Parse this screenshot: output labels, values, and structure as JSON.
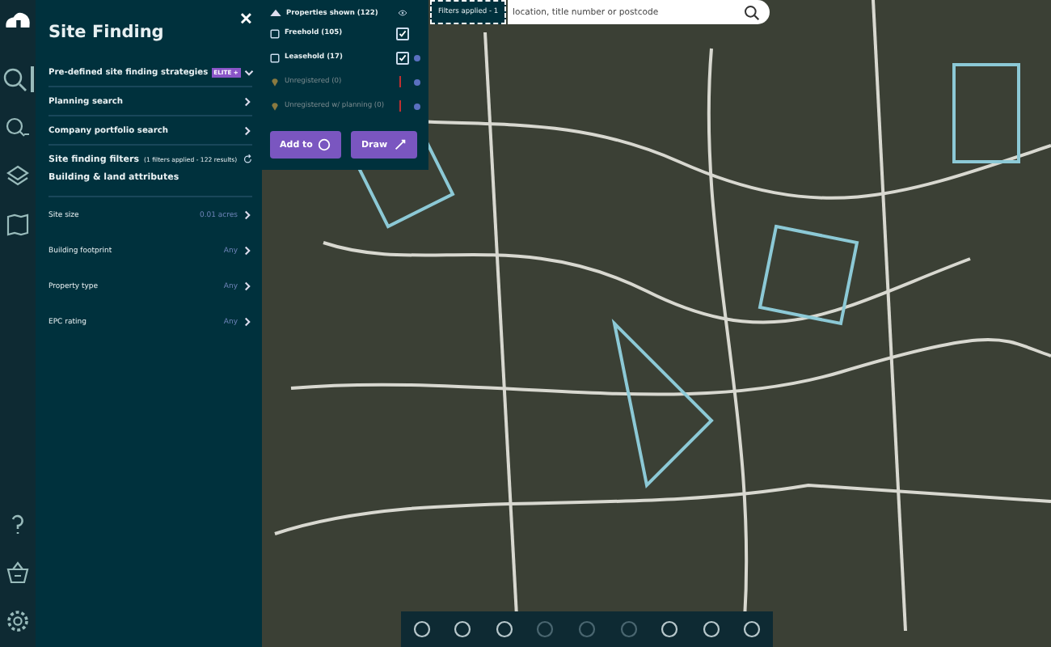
{
  "rail": {
    "top": [
      {
        "selected": true
      },
      {
        "selected": false
      },
      {
        "selected": false
      },
      {
        "selected": false
      }
    ]
  },
  "panel": {
    "title": "Site Finding",
    "close": "✕",
    "nav": [
      {
        "label": "Pre-defined site finding strategies",
        "badge": "ELITE +",
        "expanded": false
      },
      {
        "label": "Planning search"
      },
      {
        "label": "Company portfolio search"
      }
    ],
    "filters": {
      "title": "Site finding filters",
      "note": "(1 filters applied - 122 results)"
    },
    "section": "Building & land attributes",
    "attributes": [
      {
        "label": "Site size",
        "value": "0.01 acres"
      },
      {
        "label": "Building footprint",
        "value": "Any"
      },
      {
        "label": "Property type",
        "value": "Any"
      },
      {
        "label": "EPC rating",
        "value": "Any"
      }
    ]
  },
  "properties": {
    "title": "Properties shown (122)",
    "expanded": true,
    "items": [
      {
        "label": "Freehold (105)",
        "kind": "tenure",
        "checked": true,
        "disabled": false,
        "dot": false
      },
      {
        "label": "Leasehold (17)",
        "kind": "tenure",
        "checked": true,
        "disabled": false,
        "dot": true
      },
      {
        "label": "Unregistered (0)",
        "kind": "unregistered",
        "checked": false,
        "disabled": true,
        "dot": true
      },
      {
        "label": "Unregistered w/ planning (0)",
        "kind": "unregistered",
        "checked": false,
        "disabled": true,
        "dot": true
      }
    ],
    "buttons": [
      {
        "label": "Add to"
      },
      {
        "label": "Draw"
      }
    ]
  },
  "filters_badge": "Filters applied - 1",
  "search": {
    "placeholder": "location, title number or postcode"
  },
  "toolbar": [
    {
      "disabled": false
    },
    {
      "disabled": false
    },
    {
      "disabled": false
    },
    {
      "disabled": true
    },
    {
      "disabled": true
    },
    {
      "disabled": true
    },
    {
      "disabled": false
    },
    {
      "disabled": false
    },
    {
      "disabled": false
    }
  ]
}
